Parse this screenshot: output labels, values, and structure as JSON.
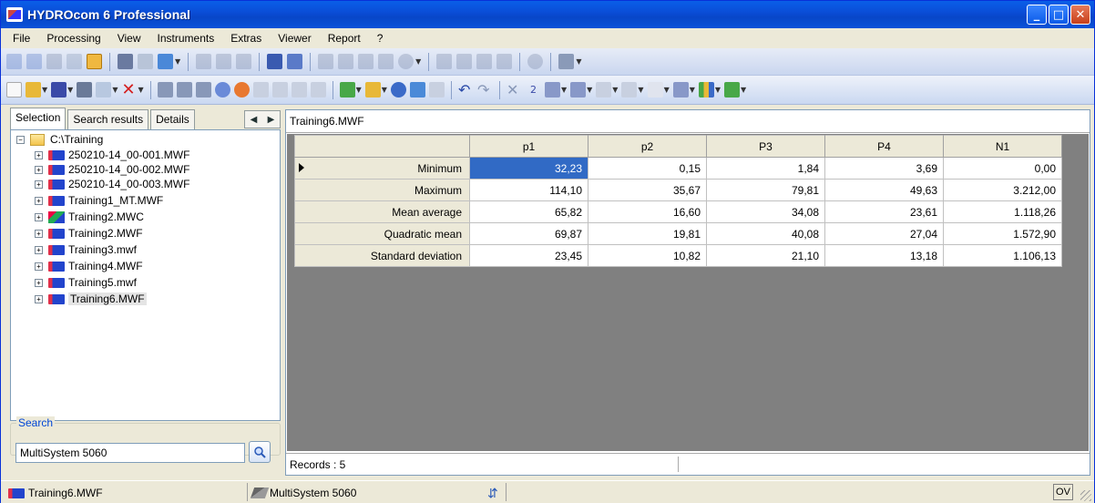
{
  "window": {
    "title": "HYDROcom 6 Professional"
  },
  "menu": [
    "File",
    "Processing",
    "View",
    "Instruments",
    "Extras",
    "Viewer",
    "Report",
    "?"
  ],
  "left_panel": {
    "tabs": [
      "Selection",
      "Search results",
      "Details"
    ],
    "tree": {
      "root": "C:\\Training",
      "items": [
        "250210-14_00-001.MWF",
        "250210-14_00-002.MWF",
        "250210-14_00-003.MWF",
        "Training1_MT.MWF",
        "Training2.MWC",
        "Training2.MWF",
        "Training3.mwf",
        "Training4.MWF",
        "Training5.mwf",
        "Training6.MWF"
      ],
      "selected": "Training6.MWF"
    },
    "search": {
      "label": "Search",
      "value": "MultiSystem 5060"
    }
  },
  "document": {
    "title": "Training6.MWF",
    "columns": [
      "p1",
      "p2",
      "P3",
      "P4",
      "N1"
    ],
    "rows": [
      {
        "label": "Minimum",
        "values": [
          "32,23",
          "0,15",
          "1,84",
          "3,69",
          "0,00"
        ]
      },
      {
        "label": "Maximum",
        "values": [
          "114,10",
          "35,67",
          "79,81",
          "49,63",
          "3.212,00"
        ]
      },
      {
        "label": "Mean average",
        "values": [
          "65,82",
          "16,60",
          "34,08",
          "23,61",
          "1.118,26"
        ]
      },
      {
        "label": "Quadratic mean",
        "values": [
          "69,87",
          "19,81",
          "40,08",
          "27,04",
          "1.572,90"
        ]
      },
      {
        "label": "Standard deviation",
        "values": [
          "23,45",
          "10,82",
          "21,10",
          "13,18",
          "1.106,13"
        ]
      }
    ],
    "records": "Records : 5"
  },
  "statusbar": {
    "file": "Training6.MWF",
    "instrument": "MultiSystem 5060",
    "mode": "OV"
  },
  "colors": {
    "title_bar": "#0a52d8",
    "selection": "#316ac5",
    "grid_bg": "#808080"
  }
}
